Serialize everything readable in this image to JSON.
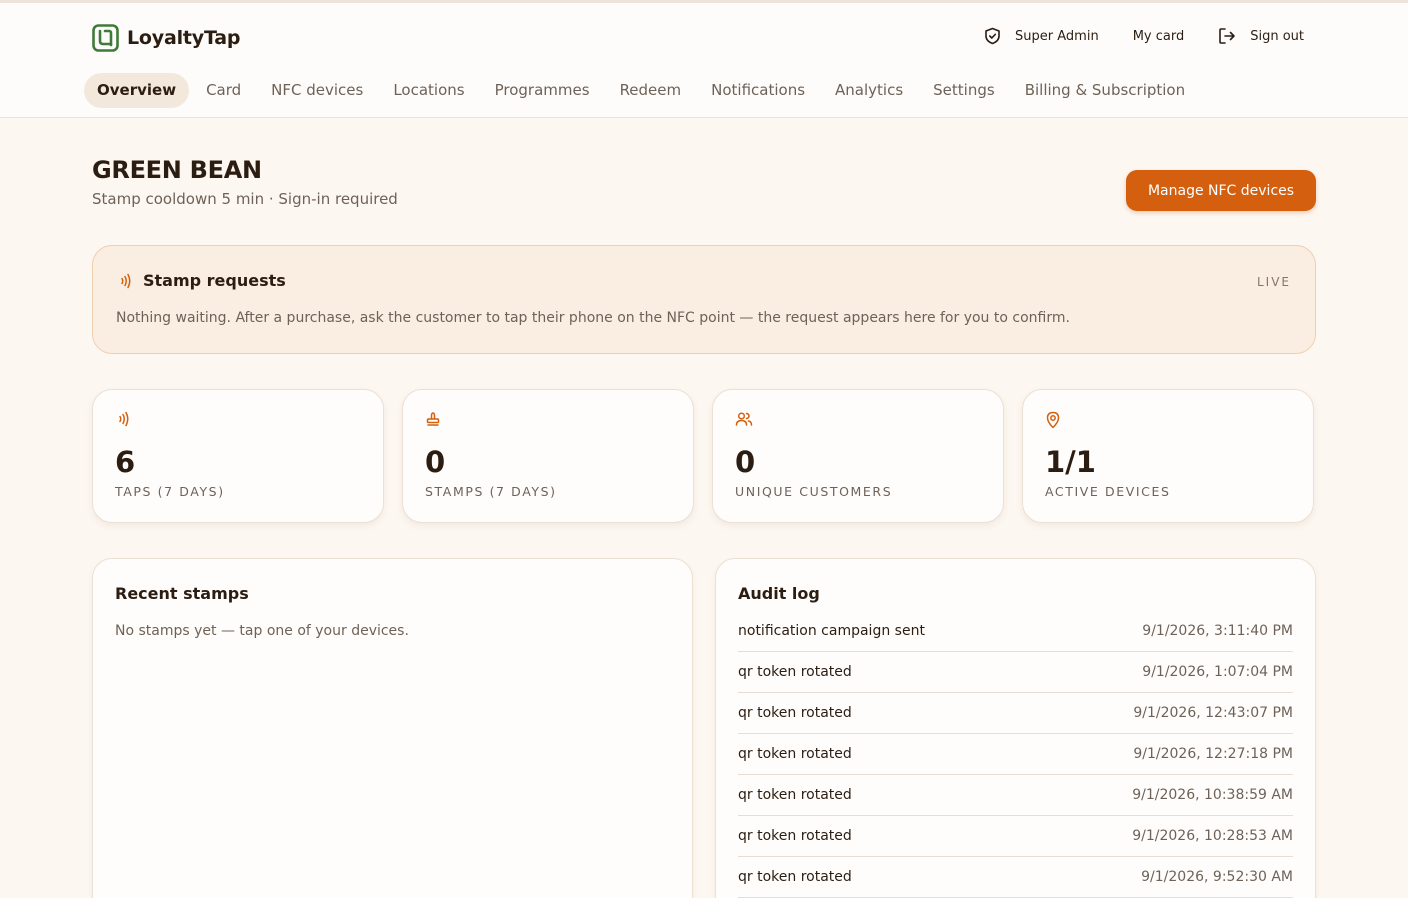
{
  "app": {
    "name": "LoyaltyTap",
    "brand_color": "#3f7a3a",
    "accent_color": "#d35f0f"
  },
  "header": {
    "actions": [
      {
        "label": "Super Admin",
        "icon": "shield-icon"
      },
      {
        "label": "My card",
        "icon": null
      },
      {
        "label": "Sign out",
        "icon": "sign-out-icon"
      }
    ]
  },
  "tabs": [
    {
      "label": "Overview",
      "active": true
    },
    {
      "label": "Card",
      "active": false
    },
    {
      "label": "NFC devices",
      "active": false
    },
    {
      "label": "Locations",
      "active": false
    },
    {
      "label": "Programmes",
      "active": false
    },
    {
      "label": "Redeem",
      "active": false
    },
    {
      "label": "Notifications",
      "active": false
    },
    {
      "label": "Analytics",
      "active": false
    },
    {
      "label": "Settings",
      "active": false
    },
    {
      "label": "Billing & Subscription",
      "active": false
    }
  ],
  "page": {
    "title": "GREEN BEAN",
    "subtitle": "Stamp cooldown 5 min · Sign-in required",
    "primary_button": "Manage NFC devices"
  },
  "stamp_requests": {
    "title": "Stamp requests",
    "status": "LIVE",
    "message": "Nothing waiting. After a purchase, ask the customer to tap their phone on the NFC point — the request appears here for you to confirm.",
    "icon": "nfc-waves-icon"
  },
  "stats": [
    {
      "value": "6",
      "label": "TAPS (7 DAYS)",
      "icon": "nfc-waves-icon"
    },
    {
      "value": "0",
      "label": "STAMPS (7 DAYS)",
      "icon": "stamp-icon"
    },
    {
      "value": "0",
      "label": "UNIQUE CUSTOMERS",
      "icon": "users-icon"
    },
    {
      "value": "1/1",
      "label": "ACTIVE DEVICES",
      "icon": "location-pin-icon"
    }
  ],
  "recent_stamps": {
    "title": "Recent stamps",
    "empty_message": "No stamps yet — tap one of your devices."
  },
  "audit_log": {
    "title": "Audit log",
    "entries": [
      {
        "action": "notification campaign sent",
        "time": "9/1/2026, 3:11:40 PM"
      },
      {
        "action": "qr token rotated",
        "time": "9/1/2026, 1:07:04 PM"
      },
      {
        "action": "qr token rotated",
        "time": "9/1/2026, 12:43:07 PM"
      },
      {
        "action": "qr token rotated",
        "time": "9/1/2026, 12:27:18 PM"
      },
      {
        "action": "qr token rotated",
        "time": "9/1/2026, 10:38:59 AM"
      },
      {
        "action": "qr token rotated",
        "time": "9/1/2026, 10:28:53 AM"
      },
      {
        "action": "qr token rotated",
        "time": "9/1/2026, 9:52:30 AM"
      }
    ]
  }
}
